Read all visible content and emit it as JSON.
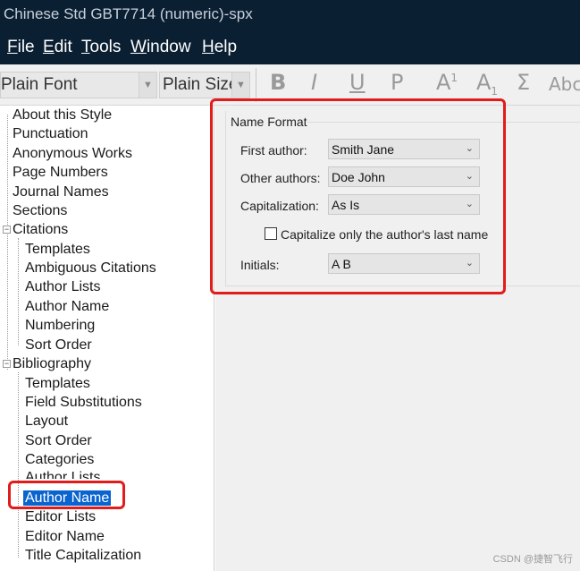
{
  "window": {
    "title": "Chinese Std GBT7714 (numeric)-spx"
  },
  "menu": [
    {
      "label_pre": "",
      "accel": "F",
      "label_post": "ile"
    },
    {
      "label_pre": "",
      "accel": "E",
      "label_post": "dit"
    },
    {
      "label_pre": "",
      "accel": "T",
      "label_post": "ools"
    },
    {
      "label_pre": "",
      "accel": "W",
      "label_post": "indow"
    },
    {
      "label_pre": "",
      "accel": "H",
      "label_post": "elp"
    }
  ],
  "toolbar": {
    "font_value": "Plain Font",
    "size_value": "Plain Size",
    "bold": "B",
    "italic": "I",
    "underline": "U",
    "plain": "P",
    "superscript_base": "A",
    "superscript_mark": "1",
    "subscript_base": "A",
    "subscript_mark": "1",
    "symbol": "Σ",
    "smallcaps": "Abc"
  },
  "tree": {
    "about": "About this Style",
    "punctuation": "Punctuation",
    "anonymous": "Anonymous Works",
    "page_numbers": "Page Numbers",
    "journal_names": "Journal Names",
    "sections": "Sections",
    "citations": "Citations",
    "cit_templates": "Templates",
    "cit_ambiguous": "Ambiguous Citations",
    "cit_author_lists": "Author Lists",
    "cit_author_name": "Author Name",
    "cit_numbering": "Numbering",
    "cit_sort_order": "Sort Order",
    "bibliography": "Bibliography",
    "bib_templates": "Templates",
    "bib_field_subs": "Field Substitutions",
    "bib_layout": "Layout",
    "bib_sort_order": "Sort Order",
    "bib_categories": "Categories",
    "bib_author_lists": "Author Lists",
    "bib_author_name": "Author Name",
    "bib_editor_lists": "Editor Lists",
    "bib_editor_name": "Editor Name",
    "bib_title_cap": "Title Capitalization"
  },
  "name_format": {
    "group_title": "Name Format",
    "first_author_label": "First author:",
    "first_author_value": "Smith Jane",
    "other_authors_label": "Other authors:",
    "other_authors_value": "Doe John",
    "capitalization_label": "Capitalization:",
    "capitalization_value": "As Is",
    "capitalize_last_label": "Capitalize only the author's last name",
    "capitalize_last_checked": false,
    "initials_label": "Initials:",
    "initials_value": "A B"
  },
  "watermark": "CSDN @捷智飞行",
  "colors": {
    "titlebar": "#0b1f33",
    "selection": "#0a64d0",
    "highlight_box": "#e21b1b"
  }
}
